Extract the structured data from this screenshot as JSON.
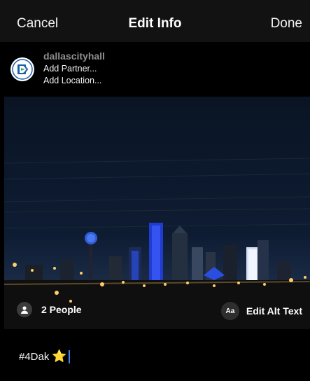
{
  "topbar": {
    "cancel": "Cancel",
    "title": "Edit Info",
    "done": "Done"
  },
  "account": {
    "avatar_icon": "city-logo-icon",
    "handle": "dallascityhall",
    "add_partner": "Add Partner...",
    "add_location": "Add Location..."
  },
  "photo": {
    "description_icon": "photo-night-skyline"
  },
  "tags": {
    "people": "2 People",
    "alt_text": "Edit Alt Text",
    "alt_icon": "Aa"
  },
  "caption": {
    "text": "#4Dak",
    "emoji": "⭐"
  },
  "colors": {
    "cursor": "#3b82f6",
    "accent_blue": "#1f4bd8"
  }
}
